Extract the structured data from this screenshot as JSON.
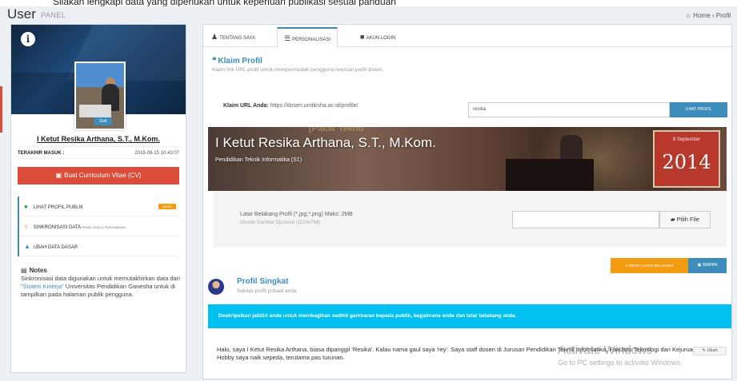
{
  "top_strip_text": "Silakan lengkapi data yang diperlukan untuk keperluan publikasi sesuai panduan",
  "header": {
    "title": "User",
    "subtitle": "PANEL",
    "breadcrumb_home": "Home",
    "breadcrumb_current": "Profil"
  },
  "sidebar": {
    "edit_label": "Edit",
    "name": "I Ketut Resika Arthana, S.T., M.Kom.",
    "last_login_label": "TERAKHIR MASUK :",
    "last_login_value": "2018-08-15 10:43:07",
    "cv_button": "Buat Curriculum Vitae (CV)",
    "menu": [
      {
        "label": "LIHAT PROFIL PUBLIK",
        "badge": "BARU"
      },
      {
        "label": "SINKRONISASI DATA",
        "small": "PENELITIAN & PENGABDIAN"
      },
      {
        "label": "UBAH DATA DASAR"
      }
    ],
    "notes_title": "Notes",
    "notes_text_1": "Sinkronisasi data digunakan untuk memutakhirkan data dari",
    "notes_link": "\"Sistem Kinerja\"",
    "notes_text_2": "Universitas Pendidikan Ganesha untuk di tampilkan pada halaman publik pengguna."
  },
  "tabs": [
    {
      "label": "TENTANG SAYA",
      "active": false
    },
    {
      "label": "PERSONALISASI",
      "active": true
    },
    {
      "label": "AKUN LOGIN",
      "active": false
    }
  ],
  "klaim": {
    "title": "Klaim Profil",
    "subtitle": "Klaim link URL profil untuk mempermudah pengguna mencari profil dosen.",
    "url_label": "Klaim URL Anda:",
    "url_prefix": "https://dosen.undiksha.ac.id/profile/",
    "input_value": "resika",
    "button": "LIHAT PROFIL"
  },
  "banner": {
    "name": "I Ketut Resika Arthana, S.T., M.Kom.",
    "dept": "Pendidikan Teknik Informatika (S1)",
    "ghost_text": "[Pakar Tekno",
    "sign_small": "8 September",
    "sign_year": "2014"
  },
  "upload": {
    "label": "Latar Belakang Profil (*.jpg,*.png) Maks: 2MB",
    "hint": "Ukuran Gambar Opsional (1024x768)",
    "button": "Pilih File"
  },
  "buttons": {
    "reset": "RESET LATAR BELAKANG",
    "save": "SIMPAN"
  },
  "profil_singkat": {
    "title": "Profil Singkat",
    "subtitle": "Sekilas profil pribadi anda.",
    "callout": "Deskripsikan jatidiri anda untuk membagikan sedikit gambaran kepada publik, bagaimana anda dan latar belakang anda.",
    "bio": "Halo, saya I Ketut Resika Arthana, biasa dipanggil 'Resika'. Kalau nama gaul saya 'rey'. Saya staff dosen di Jurusan Pendidikan Teknik Informatika, Fakultas Teknologi dan Kejuruan, Undiksha. Hobby saya naik sepeda, terutama pas turunan.",
    "edit_button": "Ubah"
  },
  "watermark": {
    "line1": "Activate Windows",
    "line2": "Go to PC settings to activate Windows."
  },
  "colors": {
    "primary": "#3c8dbc",
    "danger": "#dd4b39",
    "warning": "#f39c12",
    "info": "#00c0ef",
    "success": "#00a65a"
  }
}
